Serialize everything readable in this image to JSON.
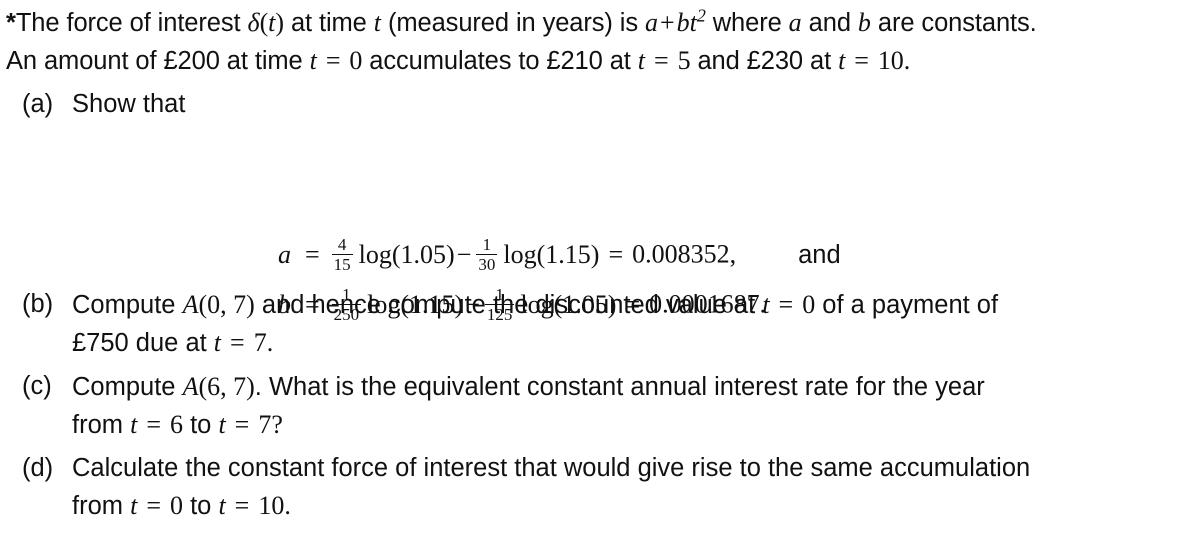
{
  "document": {
    "background_color": "#ffffff",
    "text_color": "#111111",
    "marker": "*",
    "stem": {
      "line1_part1": "The force of interest ",
      "line1_delta": "δ",
      "line1_paren_open": "(",
      "line1_t1": "t",
      "line1_paren_close": ")",
      "line1_part2": " at time ",
      "line1_t2": "t",
      "line1_part3": " (measured in years) is ",
      "line1_a": "a",
      "line1_plus": "+",
      "line1_b": "b",
      "line1_t3": "t",
      "line1_exp": "2",
      "line1_part4": " where ",
      "line1_a2": "a",
      "line1_and": " and ",
      "line1_b2": "b",
      "line1_part5": " are constants.",
      "line2_part1": "An amount of £200 at time ",
      "line2_t1": "t",
      "line2_eq1": "=",
      "line2_zero": "0",
      "line2_part2": " accumulates to £210 at ",
      "line2_t2": "t",
      "line2_eq2": "=",
      "line2_five": "5",
      "line2_part3": " and £230 at ",
      "line2_t3": "t",
      "line2_eq3": "=",
      "line2_ten": "10",
      "line2_period": "."
    },
    "parts": {
      "a": {
        "label": "(a)",
        "text": "Show that",
        "equations": [
          {
            "lhs": "a",
            "eq": "=",
            "frac1_num": "4",
            "frac1_den": "15",
            "log1": "log(1.05)",
            "operator": "−",
            "frac2_num": "1",
            "frac2_den": "30",
            "log2": "log(1.15)",
            "eq2": "=",
            "value": "0.008352,",
            "trailing": "and"
          },
          {
            "lhs": "b",
            "eq": "=",
            "frac1_num": "1",
            "frac1_den": "250",
            "log1": "log(1.15)",
            "operator": "−",
            "frac2_num": "1",
            "frac2_den": "125",
            "log2": "log(1.05)",
            "eq2": "=",
            "value": "0.0001687.",
            "trailing": ""
          }
        ]
      },
      "b": {
        "label": "(b)",
        "line1_part1": "Compute ",
        "line1_A": "A",
        "line1_args": "(0, 7)",
        "line1_part2": " and hence compute the discounted value at ",
        "line1_t": "t",
        "line1_eq": "=",
        "line1_zero": "0",
        "line1_part3": " of a payment of",
        "line2_part1": "£750 due at ",
        "line2_t": "t",
        "line2_eq": "=",
        "line2_val": "7",
        "line2_period": "."
      },
      "c": {
        "label": "(c)",
        "line1_part1": "Compute ",
        "line1_A": "A",
        "line1_args": "(6, 7)",
        "line1_part2": ". What is the equivalent constant annual interest rate for the year",
        "line2_from": "from ",
        "line2_t1": "t",
        "line2_eq1": "=",
        "line2_v1": "6",
        "line2_to": " to ",
        "line2_t2": "t",
        "line2_eq2": "=",
        "line2_v2": "7",
        "line2_q": "?"
      },
      "d": {
        "label": "(d)",
        "line1": "Calculate the constant force of interest that would give rise to the same accumulation",
        "line2_from": "from ",
        "line2_t1": "t",
        "line2_eq1": "=",
        "line2_v1": "0",
        "line2_to": " to ",
        "line2_t2": "t",
        "line2_eq2": "=",
        "line2_v2": "10",
        "line2_period": "."
      }
    }
  }
}
